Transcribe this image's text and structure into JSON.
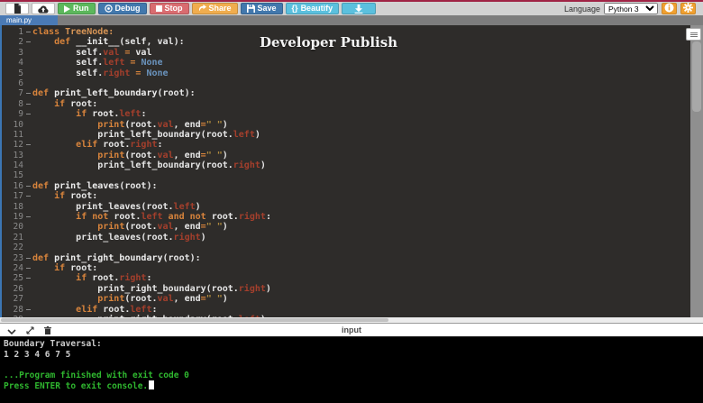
{
  "colors": {
    "top_stripe": "#a02345",
    "run_green": "#5cb85c",
    "debug_save_blue": "#4278ad",
    "stop_red": "#d96c70",
    "share_orange": "#f0ad4e",
    "beautify_cyan": "#5bc0de",
    "settings_orange": "#f0a030",
    "tab_blue": "#4a7ab5",
    "editor_bg": "#2e2c2a",
    "keyword_orange": "#d8843c",
    "attribute_red": "#a43f2c",
    "none_blue": "#6a93bd",
    "string_yellow": "#b08b3e",
    "console_green": "#2fb72f"
  },
  "toolbar": {
    "run_label": "Run",
    "debug_label": "Debug",
    "stop_label": "Stop",
    "share_label": "Share",
    "save_label": "Save",
    "beautify_label": "Beautify",
    "beautify_braces": "{}",
    "language_label": "Language",
    "language_value": "Python 3"
  },
  "tab": {
    "name": "main.py"
  },
  "editor": {
    "watermark": "Developer Publish",
    "lines": [
      {
        "num": 1,
        "fold": true,
        "tokens": [
          [
            "kw",
            "class "
          ],
          [
            "cls",
            "TreeNode:"
          ]
        ]
      },
      {
        "num": 2,
        "fold": true,
        "tokens": [
          [
            "txt",
            "    "
          ],
          [
            "kw",
            "def "
          ],
          [
            "fn",
            "__init__"
          ],
          [
            "txt",
            "(self, val):"
          ]
        ]
      },
      {
        "num": 3,
        "fold": false,
        "tokens": [
          [
            "txt",
            "        self."
          ],
          [
            "attr",
            "val"
          ],
          [
            "op",
            " = "
          ],
          [
            "txt",
            "val"
          ]
        ]
      },
      {
        "num": 4,
        "fold": false,
        "tokens": [
          [
            "txt",
            "        self."
          ],
          [
            "attr",
            "left"
          ],
          [
            "op",
            " = "
          ],
          [
            "none",
            "None"
          ]
        ]
      },
      {
        "num": 5,
        "fold": false,
        "tokens": [
          [
            "txt",
            "        self."
          ],
          [
            "attr",
            "right"
          ],
          [
            "op",
            " = "
          ],
          [
            "none",
            "None"
          ]
        ]
      },
      {
        "num": 6,
        "fold": false,
        "tokens": []
      },
      {
        "num": 7,
        "fold": true,
        "tokens": [
          [
            "kw",
            "def "
          ],
          [
            "fn",
            "print_left_boundary"
          ],
          [
            "txt",
            "(root):"
          ]
        ]
      },
      {
        "num": 8,
        "fold": true,
        "tokens": [
          [
            "txt",
            "    "
          ],
          [
            "kw",
            "if "
          ],
          [
            "txt",
            "root:"
          ]
        ]
      },
      {
        "num": 9,
        "fold": true,
        "tokens": [
          [
            "txt",
            "        "
          ],
          [
            "kw",
            "if "
          ],
          [
            "txt",
            "root."
          ],
          [
            "attr",
            "left"
          ],
          [
            "txt",
            ":"
          ]
        ]
      },
      {
        "num": 10,
        "fold": false,
        "tokens": [
          [
            "txt",
            "            "
          ],
          [
            "kw",
            "print"
          ],
          [
            "txt",
            "(root."
          ],
          [
            "attr",
            "val"
          ],
          [
            "txt",
            ", end"
          ],
          [
            "op",
            "="
          ],
          [
            "str",
            "\" \""
          ],
          [
            "txt",
            ")"
          ]
        ]
      },
      {
        "num": 11,
        "fold": false,
        "tokens": [
          [
            "txt",
            "            print_left_boundary(root."
          ],
          [
            "attr",
            "left"
          ],
          [
            "txt",
            ")"
          ]
        ]
      },
      {
        "num": 12,
        "fold": true,
        "tokens": [
          [
            "txt",
            "        "
          ],
          [
            "kw",
            "elif "
          ],
          [
            "txt",
            "root."
          ],
          [
            "attr",
            "right"
          ],
          [
            "txt",
            ":"
          ]
        ]
      },
      {
        "num": 13,
        "fold": false,
        "tokens": [
          [
            "txt",
            "            "
          ],
          [
            "kw",
            "print"
          ],
          [
            "txt",
            "(root."
          ],
          [
            "attr",
            "val"
          ],
          [
            "txt",
            ", end"
          ],
          [
            "op",
            "="
          ],
          [
            "str",
            "\" \""
          ],
          [
            "txt",
            ")"
          ]
        ]
      },
      {
        "num": 14,
        "fold": false,
        "tokens": [
          [
            "txt",
            "            print_left_boundary(root."
          ],
          [
            "attr",
            "right"
          ],
          [
            "txt",
            ")"
          ]
        ]
      },
      {
        "num": 15,
        "fold": false,
        "tokens": []
      },
      {
        "num": 16,
        "fold": true,
        "tokens": [
          [
            "kw",
            "def "
          ],
          [
            "fn",
            "print_leaves"
          ],
          [
            "txt",
            "(root):"
          ]
        ]
      },
      {
        "num": 17,
        "fold": true,
        "tokens": [
          [
            "txt",
            "    "
          ],
          [
            "kw",
            "if "
          ],
          [
            "txt",
            "root:"
          ]
        ]
      },
      {
        "num": 18,
        "fold": false,
        "tokens": [
          [
            "txt",
            "        print_leaves(root."
          ],
          [
            "attr",
            "left"
          ],
          [
            "txt",
            ")"
          ]
        ]
      },
      {
        "num": 19,
        "fold": true,
        "tokens": [
          [
            "txt",
            "        "
          ],
          [
            "kw",
            "if not "
          ],
          [
            "txt",
            "root."
          ],
          [
            "attr",
            "left"
          ],
          [
            "kw",
            " and not "
          ],
          [
            "txt",
            "root."
          ],
          [
            "attr",
            "right"
          ],
          [
            "txt",
            ":"
          ]
        ]
      },
      {
        "num": 20,
        "fold": false,
        "tokens": [
          [
            "txt",
            "            "
          ],
          [
            "kw",
            "print"
          ],
          [
            "txt",
            "(root."
          ],
          [
            "attr",
            "val"
          ],
          [
            "txt",
            ", end"
          ],
          [
            "op",
            "="
          ],
          [
            "str",
            "\" \""
          ],
          [
            "txt",
            ")"
          ]
        ]
      },
      {
        "num": 21,
        "fold": false,
        "tokens": [
          [
            "txt",
            "        print_leaves(root."
          ],
          [
            "attr",
            "right"
          ],
          [
            "txt",
            ")"
          ]
        ]
      },
      {
        "num": 22,
        "fold": false,
        "tokens": []
      },
      {
        "num": 23,
        "fold": true,
        "tokens": [
          [
            "kw",
            "def "
          ],
          [
            "fn",
            "print_right_boundary"
          ],
          [
            "txt",
            "(root):"
          ]
        ]
      },
      {
        "num": 24,
        "fold": true,
        "tokens": [
          [
            "txt",
            "    "
          ],
          [
            "kw",
            "if "
          ],
          [
            "txt",
            "root:"
          ]
        ]
      },
      {
        "num": 25,
        "fold": true,
        "tokens": [
          [
            "txt",
            "        "
          ],
          [
            "kw",
            "if "
          ],
          [
            "txt",
            "root."
          ],
          [
            "attr",
            "right"
          ],
          [
            "txt",
            ":"
          ]
        ]
      },
      {
        "num": 26,
        "fold": false,
        "tokens": [
          [
            "txt",
            "            print_right_boundary(root."
          ],
          [
            "attr",
            "right"
          ],
          [
            "txt",
            ")"
          ]
        ]
      },
      {
        "num": 27,
        "fold": false,
        "tokens": [
          [
            "txt",
            "            "
          ],
          [
            "kw",
            "print"
          ],
          [
            "txt",
            "(root."
          ],
          [
            "attr",
            "val"
          ],
          [
            "txt",
            ", end"
          ],
          [
            "op",
            "="
          ],
          [
            "str",
            "\" \""
          ],
          [
            "txt",
            ")"
          ]
        ]
      },
      {
        "num": 28,
        "fold": true,
        "tokens": [
          [
            "txt",
            "        "
          ],
          [
            "kw",
            "elif "
          ],
          [
            "txt",
            "root."
          ],
          [
            "attr",
            "left"
          ],
          [
            "txt",
            ":"
          ]
        ]
      },
      {
        "num": 29,
        "fold": false,
        "tokens": [
          [
            "txt",
            "            print_right_boundary(root."
          ],
          [
            "attr",
            "left"
          ],
          [
            "txt",
            ")"
          ]
        ]
      }
    ]
  },
  "input_bar": {
    "label": "input"
  },
  "console": {
    "lines": [
      {
        "style": "plain",
        "text": "Boundary Traversal:"
      },
      {
        "style": "plain",
        "text": "1 2 3 4 6 7 5"
      },
      {
        "style": "plain",
        "text": ""
      },
      {
        "style": "success",
        "text": "...Program finished with exit code 0"
      },
      {
        "style": "success",
        "text": "Press ENTER to exit console.",
        "cursor": true
      }
    ]
  }
}
